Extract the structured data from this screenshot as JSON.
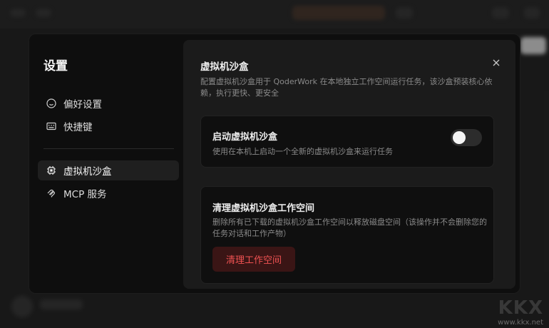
{
  "sidebar": {
    "title": "设置",
    "items": [
      {
        "label": "偏好设置",
        "icon": "smile-icon"
      },
      {
        "label": "快捷键",
        "icon": "keyboard-icon"
      },
      {
        "label": "虚拟机沙盒",
        "icon": "chip-icon",
        "active": true
      },
      {
        "label": "MCP 服务",
        "icon": "mcp-plug-icon"
      }
    ]
  },
  "content": {
    "title": "虚拟机沙盒",
    "description": "配置虚拟机沙盒用于 QoderWork 在本地独立工作空间运行任务，该沙盒预装核心依赖，执行更快、更安全",
    "enable_card": {
      "title": "启动虚拟机沙盒",
      "description": "使用在本机上启动一个全新的虚拟机沙盒来运行任务",
      "toggle_on": false
    },
    "clean_card": {
      "title": "清理虚拟机沙盒工作空间",
      "description": "删除所有已下载的虚拟机沙盒工作空间以释放磁盘空间（该操作并不会删除您的任务对话和工作产物）",
      "button_label": "清理工作空间"
    }
  },
  "watermark": {
    "url": "www.kkx.net"
  },
  "colors": {
    "danger": "#f05252",
    "danger_bg": "#3a1515"
  }
}
